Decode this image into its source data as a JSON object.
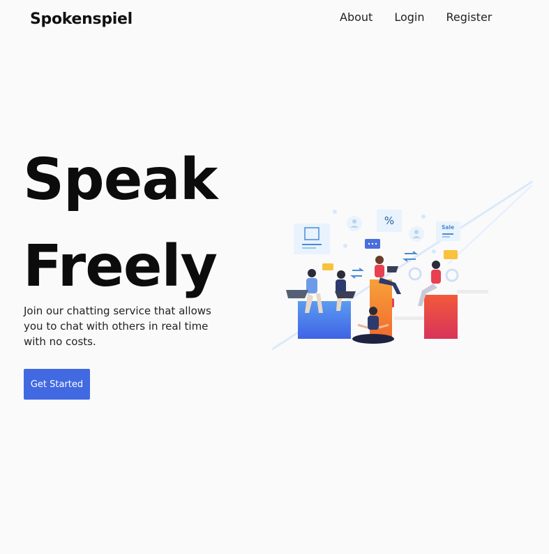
{
  "nav": {
    "brand": "Spokenspiel",
    "links": [
      "About",
      "Login",
      "Register"
    ]
  },
  "hero": {
    "title_line1": "Speak",
    "title_line2": "Freely",
    "description": "Join our chatting service that allows you to chat with others in real time with no costs.",
    "cta_label": "Get Started"
  },
  "illustration": {
    "sale_tag": "Sale",
    "percent_tag": "%"
  },
  "colors": {
    "accent": "#4169e1",
    "background": "#fafafa"
  }
}
